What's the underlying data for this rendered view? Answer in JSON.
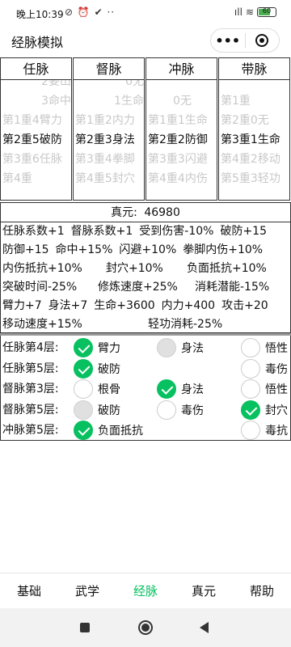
{
  "status_bar": {
    "time": "晚上10:39",
    "left_icons": "⊘ ⏰ ✔ ··",
    "signal": "ıll",
    "wifi": "≋",
    "battery": "60"
  },
  "title_bar": {
    "title": "经脉模拟",
    "more": "•••"
  },
  "pickers": [
    {
      "header": "任脉",
      "options": [
        {
          "text": "2要山",
          "state": "faded"
        },
        {
          "text": "3命中",
          "state": "faded"
        },
        {
          "text": "第1重4臂力",
          "state": "faded"
        },
        {
          "text": "第2重5破防",
          "state": "selected"
        },
        {
          "text": "第3重6任脉",
          "state": "faded"
        },
        {
          "text": "第4重",
          "state": "faded"
        }
      ]
    },
    {
      "header": "督脉",
      "options": [
        {
          "text": "0无",
          "state": "faded"
        },
        {
          "text": "1生命",
          "state": "faded"
        },
        {
          "text": "第1重2内力",
          "state": "faded"
        },
        {
          "text": "第2重3身法",
          "state": "selected"
        },
        {
          "text": "第3重4拳脚",
          "state": "faded"
        },
        {
          "text": "第4重5封穴",
          "state": "faded"
        }
      ]
    },
    {
      "header": "冲脉",
      "options": [
        {
          "text": "",
          "state": "faded"
        },
        {
          "text": "0无",
          "state": "faded"
        },
        {
          "text": "第1重1生命",
          "state": "faded"
        },
        {
          "text": "第2重2防御",
          "state": "selected"
        },
        {
          "text": "第3重3闪避",
          "state": "faded"
        },
        {
          "text": "第4重4内伤",
          "state": "faded"
        }
      ]
    },
    {
      "header": "带脉",
      "options": [
        {
          "text": "",
          "state": "faded"
        },
        {
          "text": "第1重",
          "state": "faded"
        },
        {
          "text": "第2重0无",
          "state": "faded"
        },
        {
          "text": "第3重1生命",
          "state": "selected"
        },
        {
          "text": "第4重2移动",
          "state": "faded"
        },
        {
          "text": "第5重3轻功",
          "state": "faded"
        }
      ]
    }
  ],
  "stats": {
    "zhenyuan_label": "真元:",
    "zhenyuan_value": "46980",
    "lines": [
      [
        "任脉系数+1",
        "督脉系数+1",
        "受到伤害-10%",
        "破防+15"
      ],
      [
        "防御+15",
        "命中+15%",
        "闪避+10%",
        "拳脚内伤+10%"
      ],
      [
        "内伤抵抗+10%",
        "封穴+10%",
        "负面抵抗+10%"
      ],
      [
        "突破时间-25%",
        "修炼速度+25%",
        "消耗潜能-15%"
      ],
      [
        "臂力+7",
        "身法+7",
        "生命+3600",
        "内力+400",
        "攻击+20"
      ],
      [
        "移动速度+15%",
        "轻功消耗-25%"
      ]
    ]
  },
  "levels": [
    {
      "name": "任脉第4层:",
      "choices": [
        {
          "label": "臂力",
          "state": "checked"
        },
        {
          "label": "身法",
          "state": "disabled"
        },
        {
          "label": "悟性",
          "state": "unchecked"
        }
      ]
    },
    {
      "name": "任脉第5层:",
      "choices": [
        {
          "label": "破防",
          "state": "checked"
        },
        {
          "label": "",
          "state": "none"
        },
        {
          "label": "毒伤",
          "state": "unchecked"
        }
      ]
    },
    {
      "name": "督脉第3层:",
      "choices": [
        {
          "label": "根骨",
          "state": "unchecked"
        },
        {
          "label": "身法",
          "state": "checked"
        },
        {
          "label": "悟性",
          "state": "unchecked"
        }
      ]
    },
    {
      "name": "督脉第5层:",
      "choices": [
        {
          "label": "破防",
          "state": "disabled"
        },
        {
          "label": "毒伤",
          "state": "unchecked"
        },
        {
          "label": "封穴",
          "state": "checked"
        }
      ]
    },
    {
      "name": "冲脉第5层:",
      "choices": [
        {
          "label": "负面抵抗",
          "state": "checked"
        },
        {
          "label": "",
          "state": "none"
        },
        {
          "label": "毒抗",
          "state": "unchecked"
        }
      ]
    }
  ],
  "tabs": [
    {
      "label": "基础",
      "active": false
    },
    {
      "label": "武学",
      "active": false
    },
    {
      "label": "经脉",
      "active": true
    },
    {
      "label": "真元",
      "active": false
    },
    {
      "label": "帮助",
      "active": false
    }
  ],
  "colors": {
    "accent": "#07c160",
    "faded_text": "#c8c8c8",
    "border": "#333333"
  }
}
